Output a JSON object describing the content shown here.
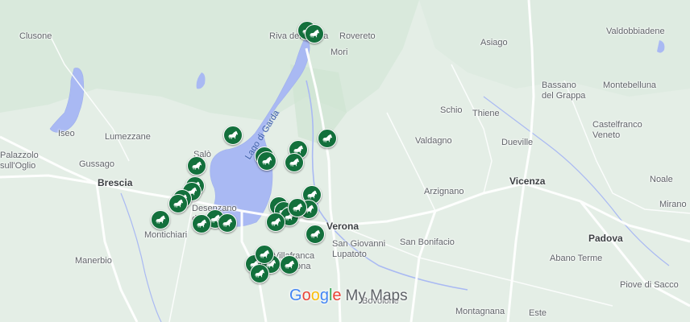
{
  "map": {
    "brand": {
      "google": "Google",
      "suffix": "My Maps"
    },
    "lake_label": "Lago di Garda",
    "colors": {
      "land": "#e4eee6",
      "water": "#a9b9f3",
      "road": "#ffffff",
      "marker": "#13703c",
      "text": "#5f6368"
    },
    "marker_icon": "horse-icon",
    "towns": [
      {
        "name": "Clusone",
        "cls": ""
      },
      {
        "name": "Riva del Garda",
        "cls": ""
      },
      {
        "name": "Rovereto",
        "cls": ""
      },
      {
        "name": "Mori",
        "cls": ""
      },
      {
        "name": "Asiago",
        "cls": ""
      },
      {
        "name": "Valdobbiadene",
        "cls": ""
      },
      {
        "name": "Bassano\ndel Grappa",
        "cls": ""
      },
      {
        "name": "Montebelluna",
        "cls": ""
      },
      {
        "name": "Schio",
        "cls": ""
      },
      {
        "name": "Thiene",
        "cls": ""
      },
      {
        "name": "Lumezzane",
        "cls": ""
      },
      {
        "name": "Iseo",
        "cls": ""
      },
      {
        "name": "Palazzolo\nsull'Oglio",
        "cls": ""
      },
      {
        "name": "Gussago",
        "cls": ""
      },
      {
        "name": "Salò",
        "cls": ""
      },
      {
        "name": "Valdagno",
        "cls": ""
      },
      {
        "name": "Castelfranco\nVeneto",
        "cls": ""
      },
      {
        "name": "Dueville",
        "cls": ""
      },
      {
        "name": "Brescia",
        "cls": "major"
      },
      {
        "name": "Vicenza",
        "cls": "major"
      },
      {
        "name": "Arzignano",
        "cls": ""
      },
      {
        "name": "Noale",
        "cls": ""
      },
      {
        "name": "Desenzano\ndel Garda",
        "cls": ""
      },
      {
        "name": "Mirano",
        "cls": ""
      },
      {
        "name": "Verona",
        "cls": "major"
      },
      {
        "name": "Montichiari",
        "cls": ""
      },
      {
        "name": "San Giovanni\nLupatoto",
        "cls": ""
      },
      {
        "name": "San Bonifacio",
        "cls": ""
      },
      {
        "name": "Padova",
        "cls": "major"
      },
      {
        "name": "Manerbio",
        "cls": ""
      },
      {
        "name": "Villafranca\ndi Verona",
        "cls": ""
      },
      {
        "name": "Abano Terme",
        "cls": ""
      },
      {
        "name": "Piove di Sacco",
        "cls": ""
      },
      {
        "name": "Bovolone",
        "cls": ""
      },
      {
        "name": "Montagnana",
        "cls": ""
      },
      {
        "name": "Este",
        "cls": ""
      }
    ],
    "marker_count": 30
  }
}
